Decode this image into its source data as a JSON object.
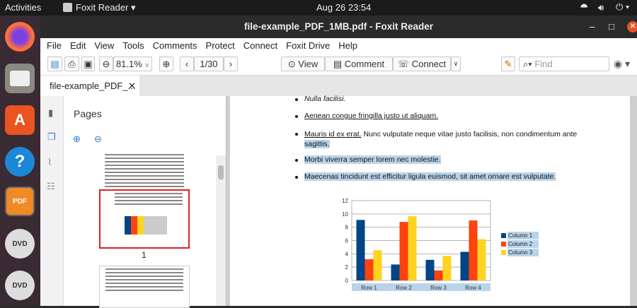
{
  "topbar": {
    "activities": "Activities",
    "app_menu": "Foxit Reader ▾",
    "clock": "Aug 26  23:54"
  },
  "dock": [
    "firefox-icon",
    "files-icon",
    "software-icon",
    "help-icon",
    "foxit-pdf-icon",
    "dvd-icon",
    "dvd-icon"
  ],
  "dock_labels": {
    "foxit": "PDF",
    "dvd": "DVD"
  },
  "window": {
    "title": "file-example_PDF_1MB.pdf - Foxit Reader"
  },
  "menu": [
    "File",
    "Edit",
    "View",
    "Tools",
    "Comments",
    "Protect",
    "Connect",
    "Foxit Drive",
    "Help"
  ],
  "toolbar": {
    "zoom": "81.1%",
    "page": "1/30",
    "view": "View",
    "comment": "Comment",
    "connect": "Connect",
    "find_placeholder": "Find"
  },
  "tab": {
    "label": "file-example_PDF_..."
  },
  "sidebar": {
    "title": "Pages",
    "page1_label": "1"
  },
  "document": {
    "lines": [
      {
        "text": "Nulla facilisi.",
        "style": "italic"
      },
      {
        "text": "Aenean congue fringilla justo ut aliquam.",
        "style": "underline"
      },
      {
        "text_a": "Mauris id ex erat.",
        "text_b": " Nunc vulputate neque vitae justo facilisis, non condimentum ante",
        "text_c": "sagittis."
      },
      {
        "text": "Morbi viverra semper lorem nec molestie."
      },
      {
        "text": "Maecenas tincidunt est efficitur ligula euismod, sit amet ornare est vulputate."
      }
    ]
  },
  "chart_data": {
    "type": "bar",
    "categories": [
      "Row 1",
      "Row 2",
      "Row 3",
      "Row 4"
    ],
    "series": [
      {
        "name": "Column 1",
        "values": [
          9.1,
          2.4,
          3.1,
          4.3
        ],
        "color": "#004586"
      },
      {
        "name": "Column 2",
        "values": [
          3.2,
          8.8,
          1.5,
          9.02
        ],
        "color": "#ff420e"
      },
      {
        "name": "Column 3",
        "values": [
          4.54,
          9.65,
          3.7,
          6.2
        ],
        "color": "#ffd320"
      }
    ],
    "yticks": [
      "0",
      "2",
      "4",
      "6",
      "8",
      "10",
      "12"
    ],
    "ylim": [
      0,
      12
    ],
    "grid": true,
    "legend": "right"
  }
}
